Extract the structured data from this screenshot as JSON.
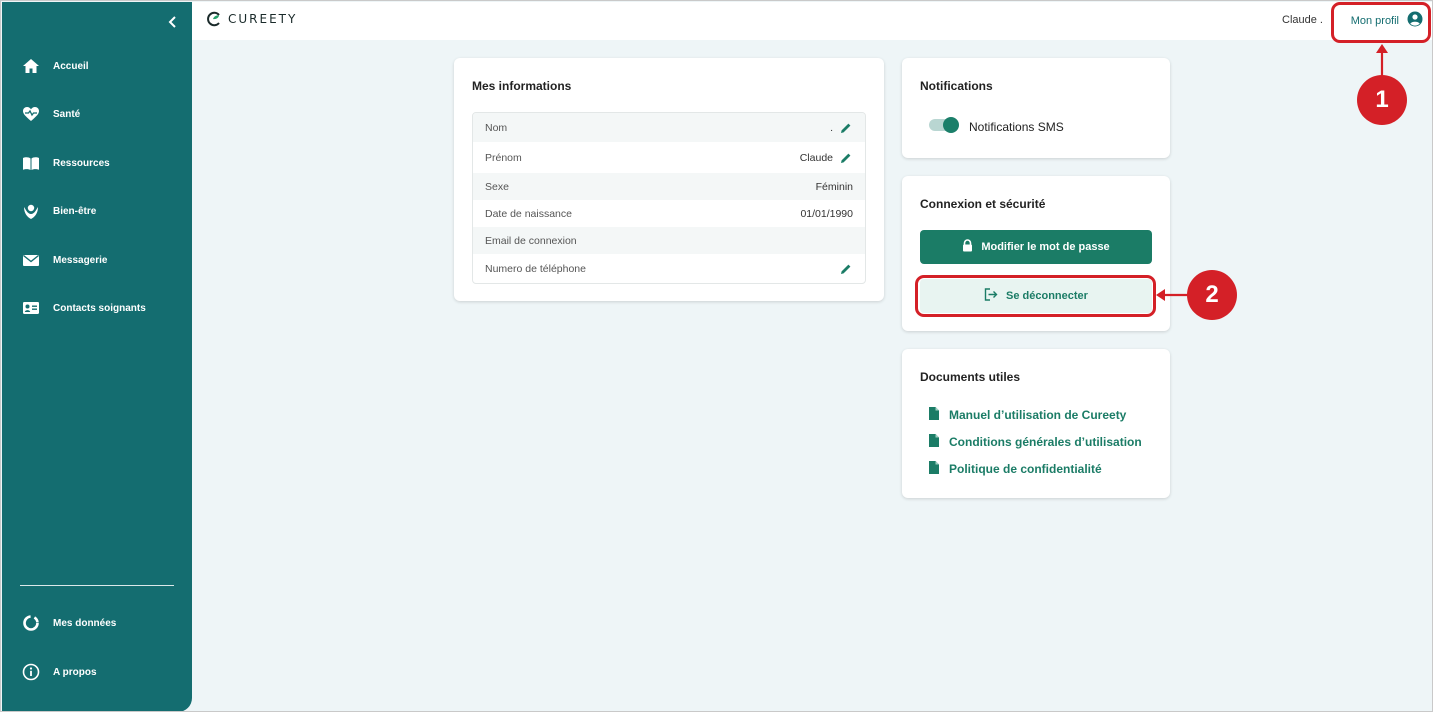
{
  "colors": {
    "sidebar": "#146d70",
    "accent": "#1b7c66",
    "annotation": "#d42027",
    "background": "#eef5f7"
  },
  "brand": {
    "logo_prefix": "C",
    "logo_text": "UREETY"
  },
  "sidebar": {
    "collapse_icon": "chevron-left-icon",
    "items": [
      {
        "label": "Accueil",
        "icon": "home-icon"
      },
      {
        "label": "Santé",
        "icon": "heart-pulse-icon"
      },
      {
        "label": "Ressources",
        "icon": "book-icon"
      },
      {
        "label": "Bien-être",
        "icon": "wellbeing-hands-icon"
      },
      {
        "label": "Messagerie",
        "icon": "envelope-icon"
      },
      {
        "label": "Contacts soignants",
        "icon": "contact-card-icon"
      }
    ],
    "bottom_items": [
      {
        "label": "Mes données",
        "icon": "donut-chart-icon"
      },
      {
        "label": "A propos",
        "icon": "info-icon"
      }
    ]
  },
  "header": {
    "user_name": "Claude .",
    "profile_label": "Mon profil",
    "profile_icon": "user-circle-icon"
  },
  "info_card": {
    "title": "Mes informations",
    "rows": [
      {
        "label": "Nom",
        "value": ".",
        "editable": true
      },
      {
        "label": "Prénom",
        "value": "Claude",
        "editable": true
      },
      {
        "label": "Sexe",
        "value": "Féminin",
        "editable": false
      },
      {
        "label": "Date de naissance",
        "value": "01/01/1990",
        "editable": false
      },
      {
        "label": "Email de connexion",
        "value": "",
        "editable": false
      },
      {
        "label": "Numero de téléphone",
        "value": "",
        "editable": true
      }
    ]
  },
  "notifications_card": {
    "title": "Notifications",
    "sms_label": "Notifications SMS",
    "sms_enabled": true
  },
  "security_card": {
    "title": "Connexion et sécurité",
    "change_password_label": "Modifier le mot de passe",
    "logout_label": "Se déconnecter"
  },
  "documents_card": {
    "title": "Documents utiles",
    "links": [
      "Manuel d’utilisation de Cureety",
      "Conditions générales d’utilisation",
      "Politique de confidentialité"
    ]
  },
  "annotations": {
    "step1": "1",
    "step2": "2"
  }
}
